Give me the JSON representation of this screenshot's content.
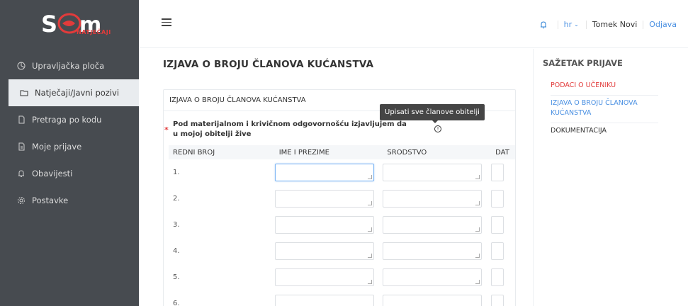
{
  "brand": {
    "logo_main": "SOM",
    "logo_sub": "NATJEČAJI"
  },
  "sidebar": {
    "items": [
      {
        "label": "Upravljačka ploča",
        "icon": "dashboard-icon"
      },
      {
        "label": "Natječaji/Javni pozivi",
        "icon": "folder-icon",
        "active": true
      },
      {
        "label": "Pretraga po kodu",
        "icon": "document-icon"
      },
      {
        "label": "Moje prijave",
        "icon": "file-list-icon"
      },
      {
        "label": "Obavijesti",
        "icon": "bell-icon"
      },
      {
        "label": "Postavke",
        "icon": "gear-icon"
      }
    ]
  },
  "topbar": {
    "language": "hr",
    "user": "Tomek Novi",
    "logout": "Odjava"
  },
  "main": {
    "title": "IZJAVA O BROJU ČLANOVA KUĆANSTVA",
    "card_title": "IZJAVA O BROJU ČLANOVA KUĆANSTVA",
    "question": "Pod materijalnom i krivičnom odgovornošću izjavljujem da u mojoj obitelji žive",
    "tooltip": "Upisati sve članove obitelji",
    "columns": [
      "REDNI BROJ",
      "IME I PREZIME",
      "SRODSTVO",
      "DAT"
    ],
    "rows": [
      "1.",
      "2.",
      "3.",
      "4.",
      "5.",
      "6."
    ]
  },
  "summary": {
    "title": "SAŽETAK PRIJAVE",
    "items": [
      {
        "label": "PODACI O UČENIKU",
        "status": "error"
      },
      {
        "label": "IZJAVA O BROJU ČLANOVA KUĆANSTVA",
        "status": "current"
      },
      {
        "label": "DOKUMENTACIJA",
        "status": "default"
      }
    ]
  },
  "colors": {
    "sidebar_bg": "#474b50",
    "accent": "#4a90e2",
    "error": "#e23b3b"
  }
}
